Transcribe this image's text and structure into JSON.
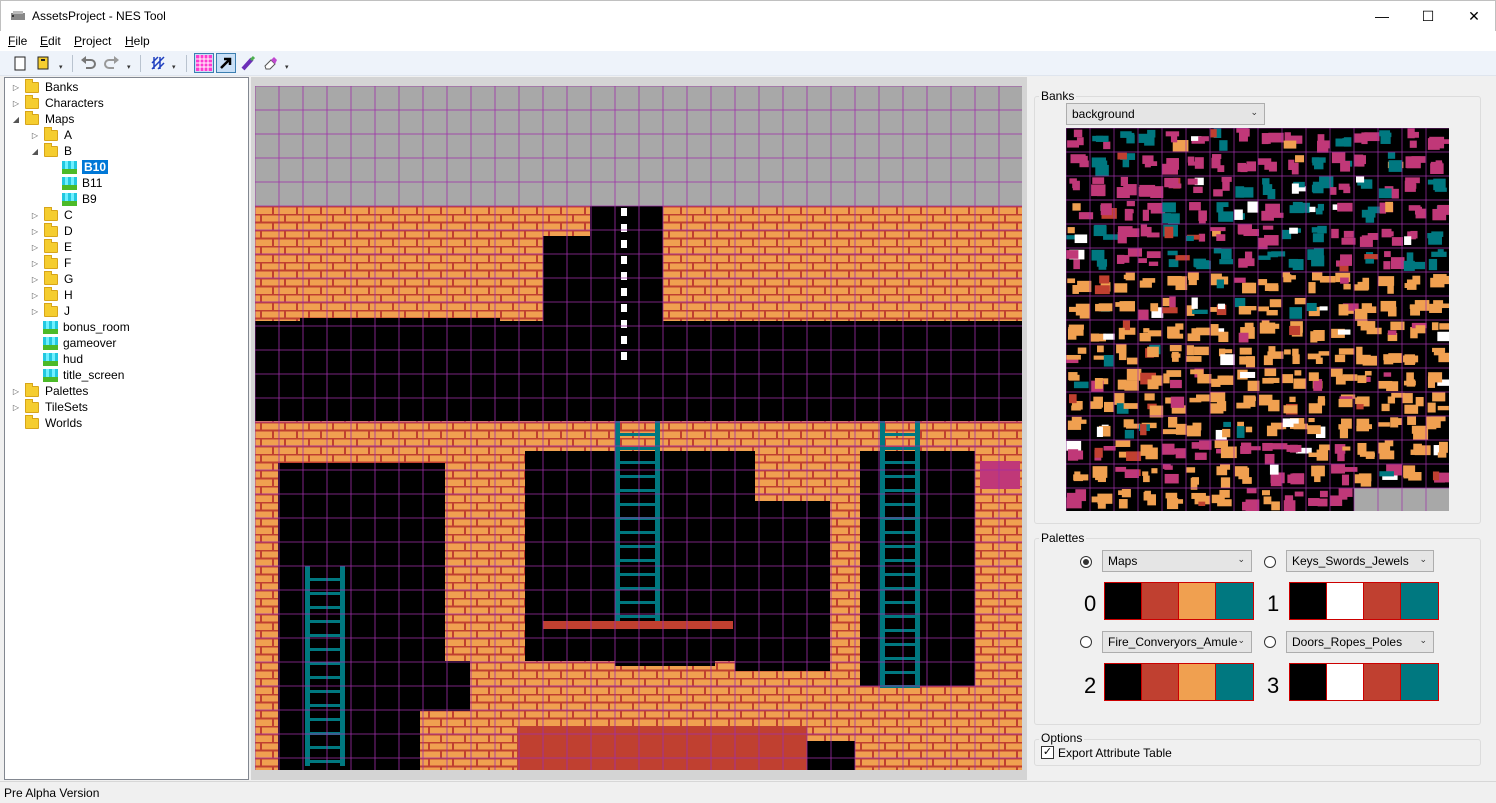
{
  "window": {
    "title": "AssetsProject - NES Tool",
    "minimize": "—",
    "maximize": "☐",
    "close": "✕"
  },
  "menu": [
    {
      "accel": "F",
      "rest": "ile"
    },
    {
      "accel": "E",
      "rest": "dit"
    },
    {
      "accel": "P",
      "rest": "roject"
    },
    {
      "accel": "H",
      "rest": "elp"
    }
  ],
  "toolbar": {
    "new_icon": "new-file-icon",
    "open_icon": "open-folder-icon",
    "undo_icon": "undo-icon",
    "redo_icon": "redo-icon",
    "grid_toggle_icon": "grid-icon",
    "select_icon": "arrow-icon",
    "paint_icon": "brush-icon",
    "erase_icon": "eraser-icon",
    "dropdown_glyph": "▾"
  },
  "tree": {
    "nodes": [
      {
        "label": "Banks",
        "expander": "▷"
      },
      {
        "label": "Characters",
        "expander": "▷"
      },
      {
        "label": "Maps",
        "expander": "◢"
      },
      {
        "label": "A",
        "expander": "▷"
      },
      {
        "label": "B",
        "expander": "◢"
      },
      {
        "label": "B10",
        "expander": ""
      },
      {
        "label": "B11",
        "expander": ""
      },
      {
        "label": "B9",
        "expander": ""
      },
      {
        "label": "C",
        "expander": "▷"
      },
      {
        "label": "D",
        "expander": "▷"
      },
      {
        "label": "E",
        "expander": "▷"
      },
      {
        "label": "F",
        "expander": "▷"
      },
      {
        "label": "G",
        "expander": "▷"
      },
      {
        "label": "H",
        "expander": "▷"
      },
      {
        "label": "J",
        "expander": "▷"
      },
      {
        "label": "bonus_room",
        "expander": ""
      },
      {
        "label": "gameover",
        "expander": ""
      },
      {
        "label": "hud",
        "expander": ""
      },
      {
        "label": "title_screen",
        "expander": ""
      },
      {
        "label": "Palettes",
        "expander": "▷"
      },
      {
        "label": "TileSets",
        "expander": "▷"
      },
      {
        "label": "Worlds",
        "expander": ""
      }
    ],
    "selected": "B10"
  },
  "banks": {
    "group_label": "Banks",
    "selected": "background",
    "arrow": "⌄"
  },
  "palettes": {
    "group_label": "Palettes",
    "slots": [
      {
        "index": "0",
        "name": "Maps",
        "checked": true,
        "colors": [
          "#000000",
          "#c04030",
          "#f0a050",
          "#007880"
        ]
      },
      {
        "index": "1",
        "name": "Keys_Swords_Jewels",
        "checked": false,
        "colors": [
          "#000000",
          "#ffffff",
          "#c04030",
          "#007880"
        ]
      },
      {
        "index": "2",
        "name": "Fire_Converyors_Amule",
        "checked": false,
        "colors": [
          "#000000",
          "#c04030",
          "#f0a050",
          "#007880"
        ]
      },
      {
        "index": "3",
        "name": "Doors_Ropes_Poles",
        "checked": false,
        "colors": [
          "#000000",
          "#ffffff",
          "#c04030",
          "#007880"
        ]
      }
    ]
  },
  "options": {
    "group_label": "Options",
    "export_attribute_table": "Export Attribute Table",
    "export_checked": true,
    "check_glyph": "✓"
  },
  "status": {
    "text": "Pre Alpha Version"
  },
  "colors": {
    "brick": "#f0a050",
    "mortar": "#c04030",
    "ladder": "#007880",
    "sky": "#a8a8a8",
    "grid": "#9f2fa8",
    "magenta": "#c03878"
  }
}
